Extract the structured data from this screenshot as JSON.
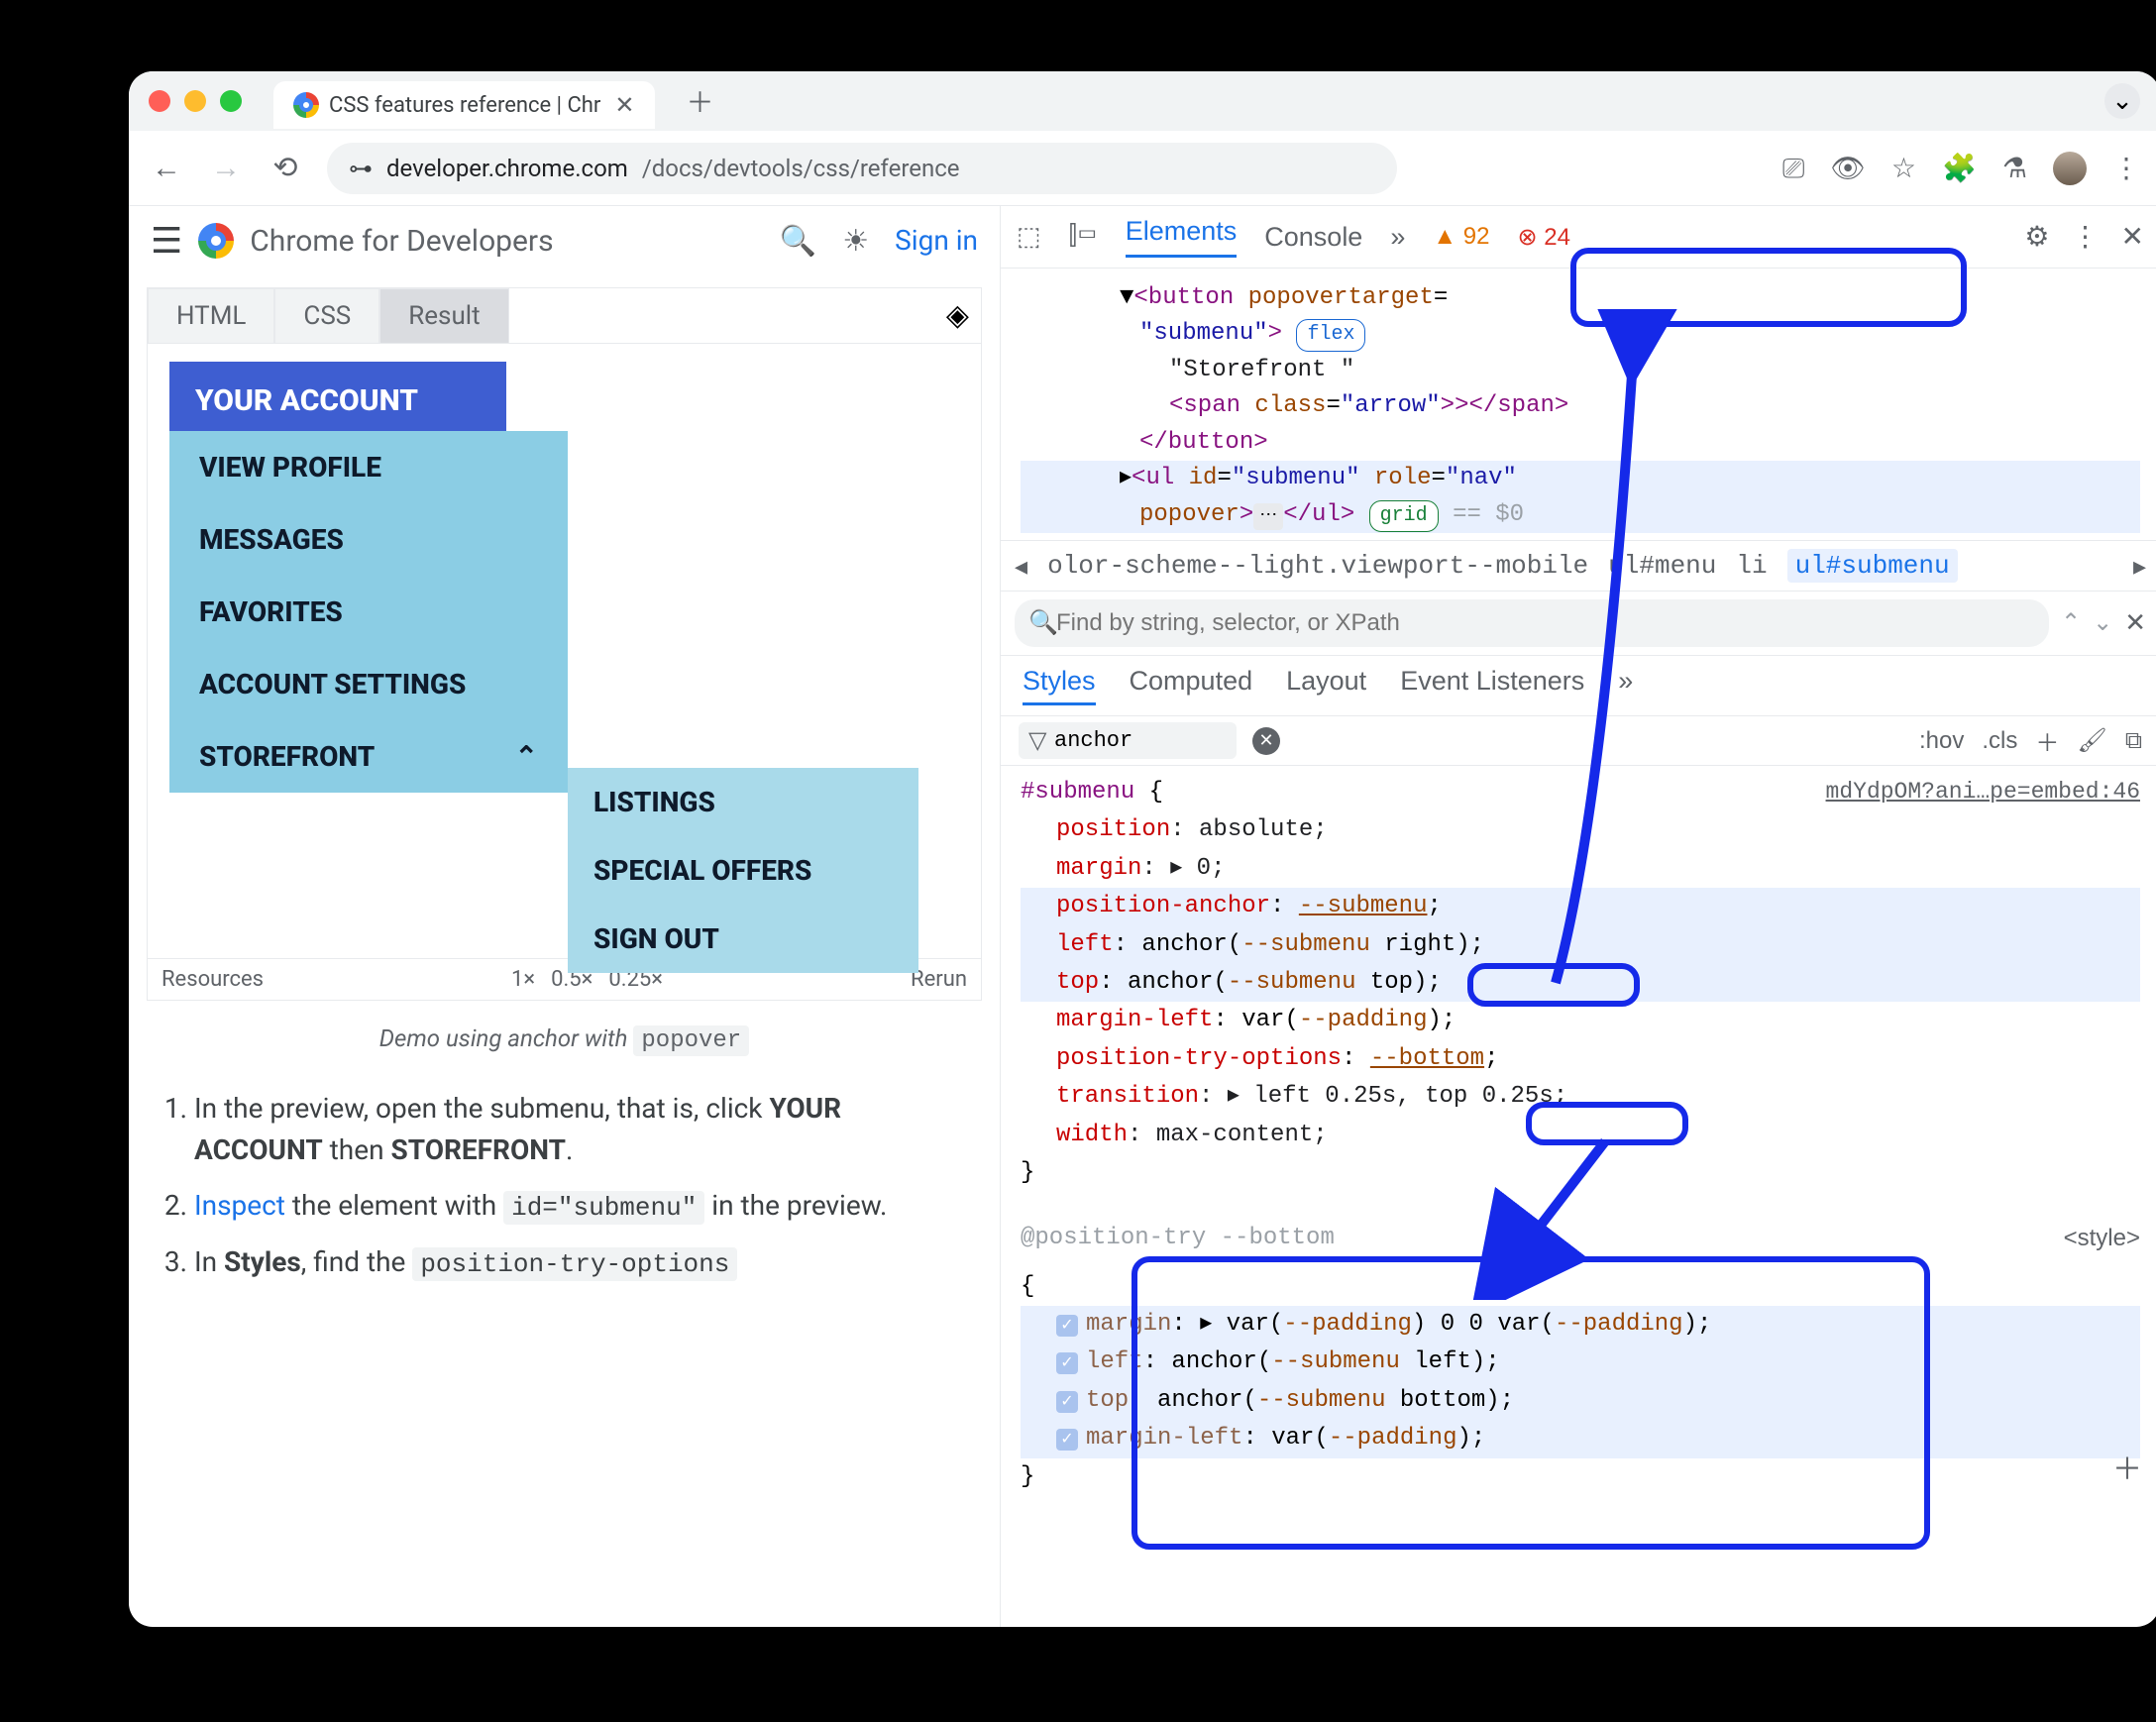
{
  "browser": {
    "tab_title": "CSS features reference | Chr",
    "url_domain": "developer.chrome.com",
    "url_path": "/docs/devtools/css/reference"
  },
  "site_header": {
    "title": "Chrome for Developers",
    "signin": "Sign in"
  },
  "embed": {
    "tabs": [
      "HTML",
      "CSS",
      "Result"
    ],
    "menu_root": "YOUR ACCOUNT",
    "menu_items": [
      "VIEW PROFILE",
      "MESSAGES",
      "FAVORITES",
      "ACCOUNT SETTINGS",
      "STOREFRONT"
    ],
    "submenu_items": [
      "LISTINGS",
      "SPECIAL OFFERS",
      "SIGN OUT"
    ],
    "footer": {
      "resources": "Resources",
      "z1": "1×",
      "z05": "0.5×",
      "z025": "0.25×",
      "rerun": "Rerun"
    },
    "caption_pre": "Demo using anchor with ",
    "caption_code": "popover"
  },
  "steps": {
    "s1a": "In the preview, open the submenu, that is, click ",
    "s1b": "YOUR ACCOUNT",
    "s1c": " then ",
    "s1d": "STOREFRONT",
    "s2a": "Inspect",
    "s2b": " the element with ",
    "s2code": "id=\"submenu\"",
    "s2c": " in the preview.",
    "s3a": "In ",
    "s3b": "Styles",
    "s3c": ", find the ",
    "s3code": "position-try-options"
  },
  "devtools": {
    "tabs": {
      "elements": "Elements",
      "console": "Console"
    },
    "warn_count": "92",
    "err_count": "24",
    "dom": {
      "l1a": "<button ",
      "l1b": "popovertarget",
      "l1c": "=",
      "l2a": "\"submenu\"",
      "l2b": ">",
      "l2badge": "flex",
      "l3": "\"Storefront \"",
      "l4a": "<span ",
      "l4b": "class",
      "l4c": "=",
      "l4d": "\"arrow\"",
      "l4e": ">></span>",
      "l5": "</button>",
      "l6a": "<ul ",
      "l6b": "id",
      "l6c": "=",
      "l6d": "\"submenu\" ",
      "l6e": "role",
      "l6f": "=",
      "l6g": "\"nav\"",
      "l7a": "popover",
      "l7b": ">",
      "l7c": "</ul>",
      "l7badge": "grid",
      "l7d": " == $0"
    },
    "crumbs": {
      "c1": "olor-scheme--light.viewport--mobile",
      "c2": "ul#menu",
      "c3": "li",
      "c4": "ul#submenu"
    },
    "find_placeholder": "Find by string, selector, or XPath",
    "styles_tabs": [
      "Styles",
      "Computed",
      "Layout",
      "Event Listeners"
    ],
    "filter_value": "anchor",
    "filter_actions": {
      "hov": ":hov",
      "cls": ".cls"
    },
    "rule": {
      "selector": "#submenu",
      "src": "mdYdpOM?ani…pe=embed:46",
      "p1n": "position",
      "p1v": ": absolute;",
      "p2n": "margin",
      "p2v": ": ▸ 0;",
      "p3n": "position-anchor",
      "p3v": ": ",
      "p3var": "--submenu",
      "p3e": ";",
      "p4n": "left",
      "p4v": ": anchor(",
      "p4var": "--submenu",
      "p4e": " right);",
      "p5n": "top",
      "p5v": ": anchor(",
      "p5var": "--submenu",
      "p5e": " top);",
      "p6n": "margin-left",
      "p6v": ": var(",
      "p6var": "--padding",
      "p6e": ");",
      "p7n": "position-try-options",
      "p7v": ": ",
      "p7var": "--bottom",
      "p7e": ";",
      "p8n": "transition",
      "p8v": ": ▸ left 0.25s, top 0.25s;",
      "p9n": "width",
      "p9v": ": max-content;"
    },
    "at": {
      "hdr": "@position-try --bottom",
      "style": "<style>",
      "p1n": "margin",
      "p1v": ": ▸ var(",
      "p1var1": "--padding",
      "p1m": ") 0 0 var(",
      "p1var2": "--padding",
      "p1e": ");",
      "p2n": "left",
      "p2v": ": anchor(",
      "p2var": "--submenu",
      "p2e": " left);",
      "p3n": "top",
      "p3v": ": anchor(",
      "p3var": "--submenu",
      "p3e": " bottom);",
      "p4n": "margin-left",
      "p4v": ": var(",
      "p4var": "--padding",
      "p4e": ");"
    }
  }
}
